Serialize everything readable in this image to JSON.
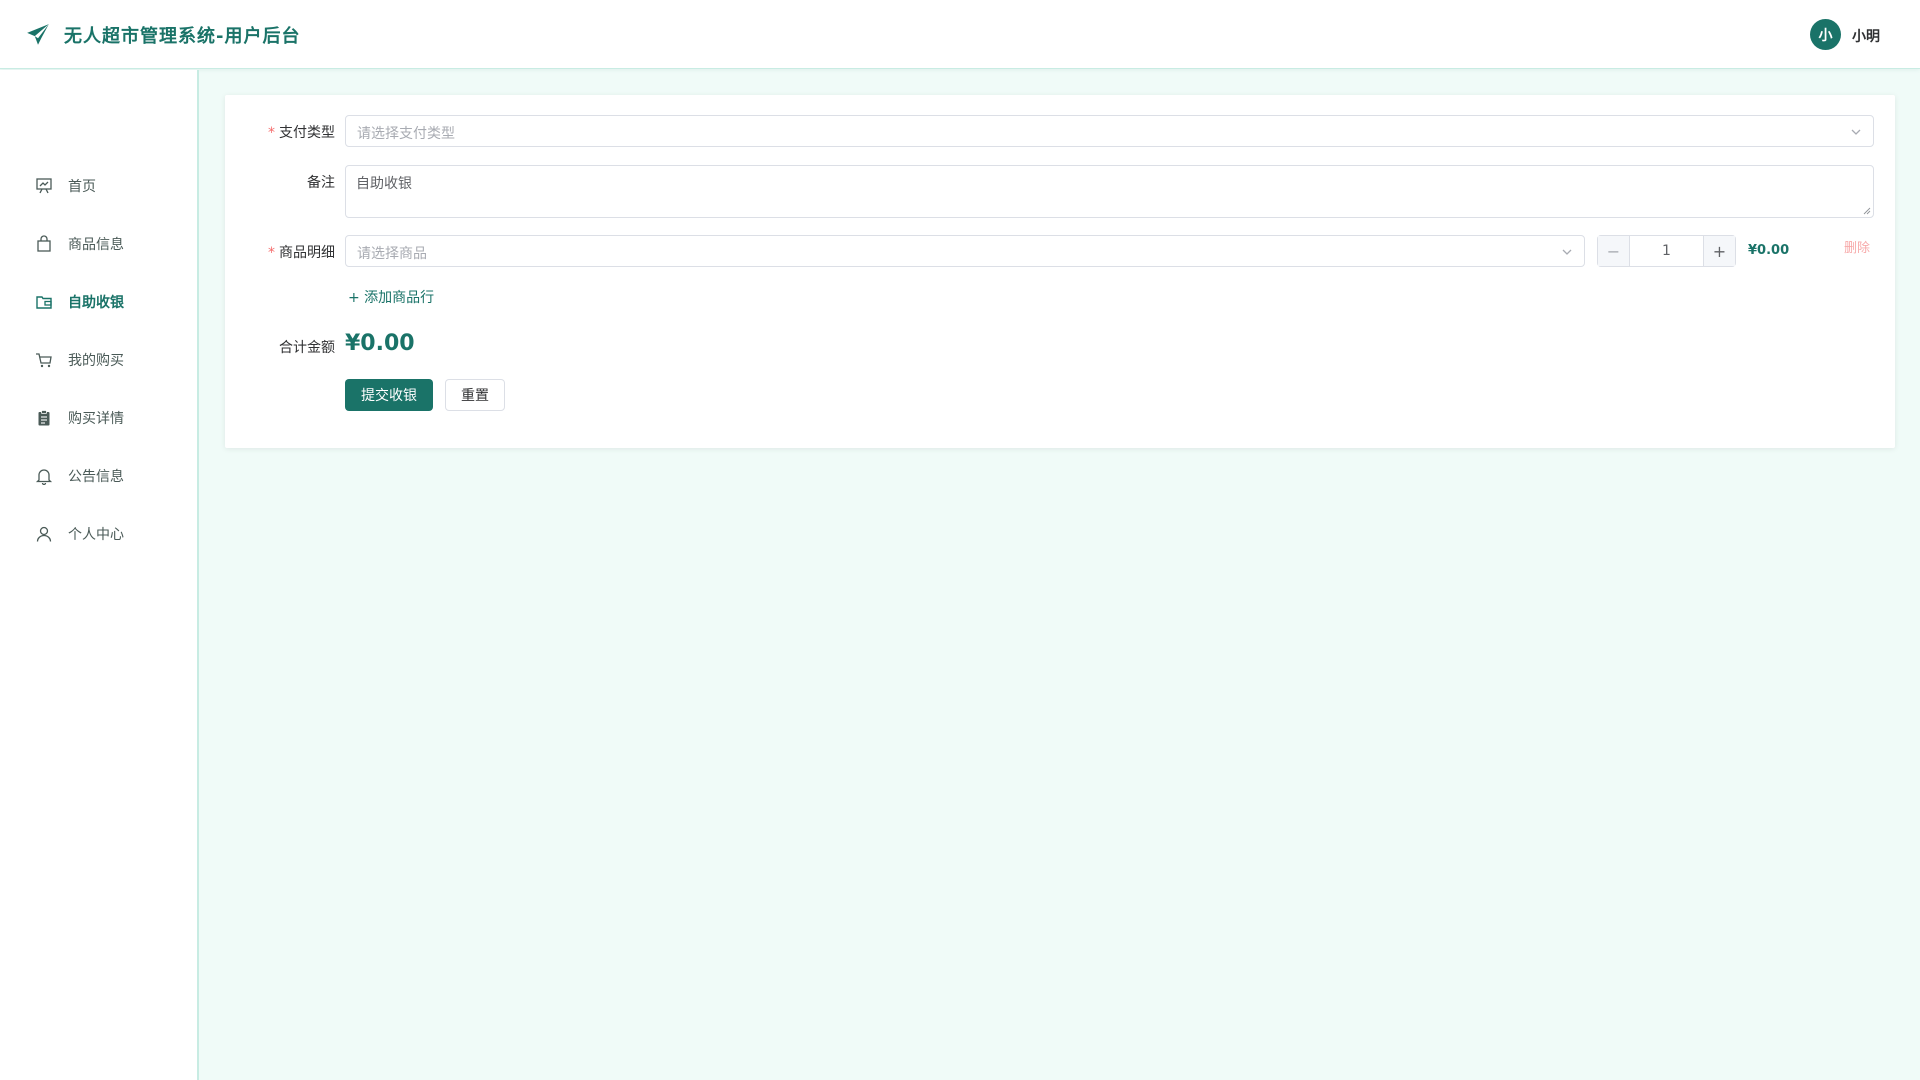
{
  "header": {
    "title": "无人超市管理系统-用户后台",
    "logo_icon": "paper-plane-icon",
    "avatar_text": "小",
    "user_name": "小明"
  },
  "sidebar": {
    "items": [
      {
        "label": "首页",
        "icon": "presentation-chart-icon",
        "active": false
      },
      {
        "label": "商品信息",
        "icon": "shopping-bag-icon",
        "active": false
      },
      {
        "label": "自助收银",
        "icon": "wallet-icon",
        "active": true
      },
      {
        "label": "我的购买",
        "icon": "cart-icon",
        "active": false
      },
      {
        "label": "购买详情",
        "icon": "clipboard-icon",
        "active": false
      },
      {
        "label": "公告信息",
        "icon": "bell-icon",
        "active": false
      },
      {
        "label": "个人中心",
        "icon": "user-icon",
        "active": false
      }
    ]
  },
  "form": {
    "payment_type": {
      "required_mark": "*",
      "label": "支付类型",
      "placeholder": "请选择支付类型"
    },
    "remark": {
      "label": "备注",
      "value": "自助收银"
    },
    "items": {
      "required_mark": "*",
      "label": "商品明细",
      "placeholder": "请选择商品",
      "minus": "−",
      "plus": "+",
      "quantity": "1",
      "line_price": "¥0.00",
      "delete_label": "删除"
    },
    "add_row_label": "+ 添加商品行",
    "total": {
      "label": "合计金额",
      "value": "¥0.00"
    },
    "submit_label": "提交收银",
    "reset_label": "重置"
  },
  "colors": {
    "accent": "#1a7368",
    "background": "#f0fbf8",
    "danger": "#f56c6c"
  }
}
